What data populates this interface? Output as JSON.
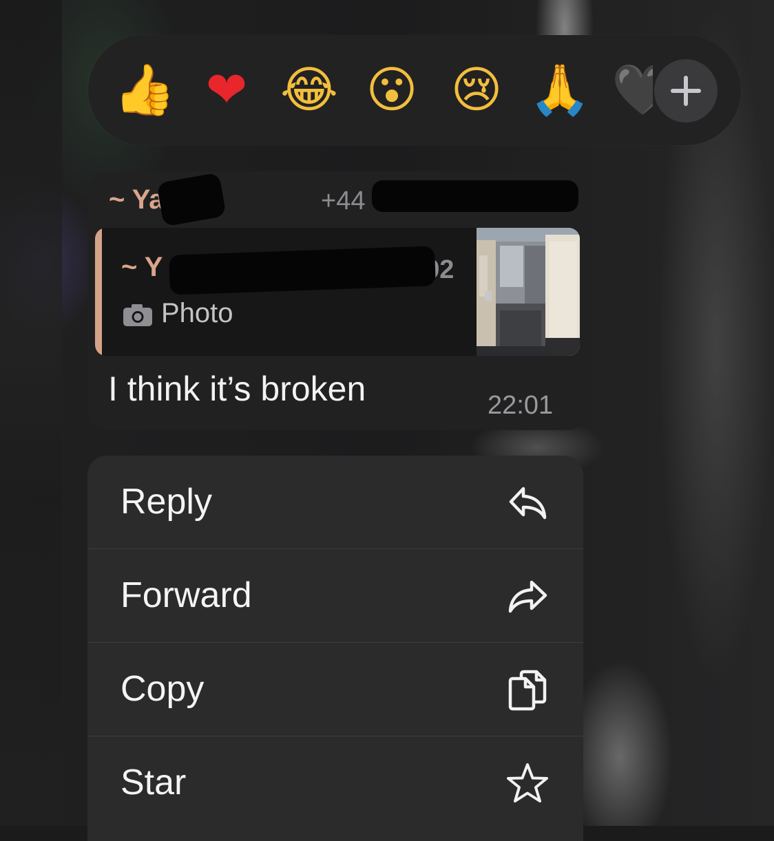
{
  "reactions": {
    "emojis": [
      {
        "name": "thumbs-up",
        "glyph": "👍"
      },
      {
        "name": "red-heart",
        "glyph": "❤"
      },
      {
        "name": "tears-of-joy",
        "glyph": "😂"
      },
      {
        "name": "surprised",
        "glyph": "😮"
      },
      {
        "name": "crying",
        "glyph": "😢"
      },
      {
        "name": "praying-hands",
        "glyph": "🙏"
      },
      {
        "name": "black-heart",
        "glyph": "🖤"
      }
    ],
    "more_icon": "plus-icon"
  },
  "message": {
    "sender": "~ Yaz",
    "sender_phone": "+44",
    "quoted": {
      "sender": "~ Y",
      "number_fragment": "392",
      "type_label": "Photo",
      "type_icon": "camera-icon"
    },
    "text": "I think it’s broken",
    "time": "22:01"
  },
  "menu": {
    "items": [
      {
        "label": "Reply",
        "icon": "reply-icon"
      },
      {
        "label": "Forward",
        "icon": "forward-icon"
      },
      {
        "label": "Copy",
        "icon": "copy-icon"
      },
      {
        "label": "Star",
        "icon": "star-icon"
      }
    ]
  },
  "colors": {
    "sender_name": "#d9a58c",
    "bubble": "#212122",
    "menu": "#2b2b2c",
    "quote_bar": "#d5a388"
  }
}
